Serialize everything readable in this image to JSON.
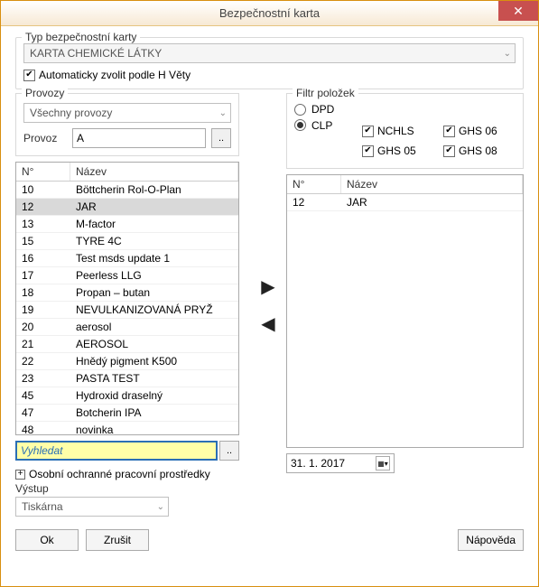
{
  "window": {
    "title": "Bezpečnostní karta"
  },
  "card_type": {
    "label": "Typ bezpečnostní karty",
    "value": "KARTA CHEMICKÉ LÁTKY",
    "auto_label": "Automaticky zvolit podle H Věty"
  },
  "provozy": {
    "label": "Provozy",
    "all": "Všechny provozy",
    "provoz_label": "Provoz",
    "provoz_value": "A"
  },
  "filter": {
    "label": "Filtr položek",
    "dpd": "DPD",
    "clp": "CLP",
    "chk": {
      "nchls": "NCHLS",
      "ghs05": "GHS 05",
      "ghs06": "GHS 06",
      "ghs08": "GHS 08"
    }
  },
  "left_table": {
    "headers": {
      "n": "N°",
      "name": "Název"
    },
    "rows": [
      {
        "n": "10",
        "name": "Böttcherin Rol-O-Plan"
      },
      {
        "n": "12",
        "name": "JAR",
        "sel": true
      },
      {
        "n": "13",
        "name": "M-factor"
      },
      {
        "n": "15",
        "name": "TYRE 4C"
      },
      {
        "n": "16",
        "name": "Test msds update 1"
      },
      {
        "n": "17",
        "name": "Peerless LLG"
      },
      {
        "n": "18",
        "name": "Propan – butan"
      },
      {
        "n": "19",
        "name": "NEVULKANIZOVANÁ PRYŽ"
      },
      {
        "n": "20",
        "name": "aerosol"
      },
      {
        "n": "21",
        "name": "AEROSOL"
      },
      {
        "n": "22",
        "name": "Hnědý pigment K500"
      },
      {
        "n": "23",
        "name": "PASTA TEST"
      },
      {
        "n": "45",
        "name": "Hydroxid draselný"
      },
      {
        "n": "47",
        "name": "Botcherin IPA"
      },
      {
        "n": "48",
        "name": "novinka"
      }
    ]
  },
  "right_table": {
    "headers": {
      "n": "N°",
      "name": "Název"
    },
    "rows": [
      {
        "n": "12",
        "name": "JAR"
      }
    ]
  },
  "search": {
    "placeholder": "Vyhledat"
  },
  "date": {
    "value": "31.   1. 2017"
  },
  "expander": {
    "label": "Osobní ochranné pracovní prostředky"
  },
  "vystup": {
    "label": "Výstup",
    "value": "Tiskárna"
  },
  "buttons": {
    "ok": "Ok",
    "cancel": "Zrušit",
    "help": "Nápověda"
  }
}
